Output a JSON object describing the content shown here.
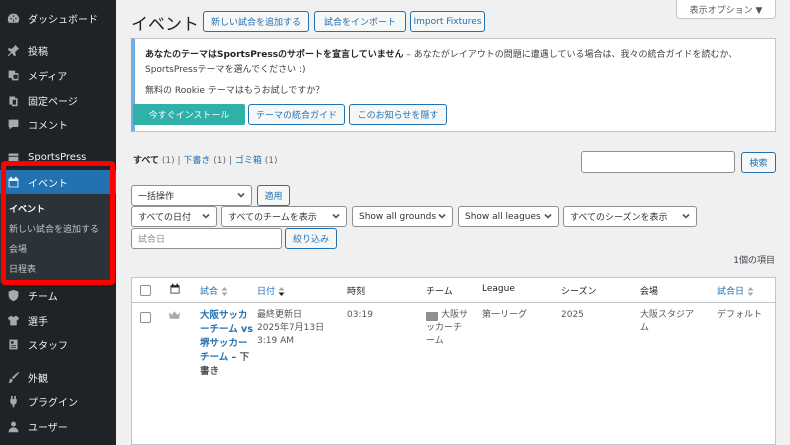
{
  "sidebar": {
    "items": [
      {
        "label": "ダッシュボード",
        "icon": "dashboard-icon"
      },
      {
        "label": "投稿",
        "icon": "pin-icon"
      },
      {
        "label": "メディア",
        "icon": "media-icon"
      },
      {
        "label": "固定ページ",
        "icon": "page-icon"
      },
      {
        "label": "コメント",
        "icon": "comment-icon"
      },
      {
        "label": "SportsPress",
        "icon": "sportspress-icon"
      },
      {
        "label": "イベント",
        "icon": "calendar-icon"
      },
      {
        "label": "チーム",
        "icon": "shield-icon"
      },
      {
        "label": "選手",
        "icon": "shirt-icon"
      },
      {
        "label": "スタッフ",
        "icon": "id-card-icon"
      },
      {
        "label": "外観",
        "icon": "brush-icon"
      },
      {
        "label": "プラグイン",
        "icon": "plugin-icon"
      },
      {
        "label": "ユーザー",
        "icon": "user-icon"
      }
    ],
    "submenu": [
      "イベント",
      "新しい試合を追加する",
      "会場",
      "日程表"
    ]
  },
  "header": {
    "title": "イベント",
    "buttons": [
      "新しい試合を追加する",
      "試合をインポート",
      "Import Fixtures"
    ],
    "screen_options": "表示オプション ▼"
  },
  "notice": {
    "bold": "あなたのテーマはSportsPressのサポートを宣言していません",
    "text_1": " – あなたがレイアウトの問題に遭遇している場合は、我々の統合ガイドを読むか、",
    "text_2": "SportsPressテーマを選んでください :)",
    "text_3": "無料の Rookie テーマはもうお試しですか？",
    "install": "今すぐインストール",
    "guide": "テーマの統合ガイド",
    "hide": "このお知らせを隠す"
  },
  "views": {
    "all": "すべて",
    "all_count": " (1) ",
    "sep": "|",
    "draft": "下書き",
    "draft_count": " (1) ",
    "trash": "ゴミ箱",
    "trash_count": " (1)"
  },
  "search": {
    "button": "検索",
    "placeholder": ""
  },
  "filters": {
    "bulk": "一括操作",
    "apply": "適用",
    "dates": "すべての日付",
    "teams": "すべてのチームを表示",
    "grounds": "Show all grounds",
    "leagues": "Show all leagues",
    "seasons": "すべてのシーズンを表示",
    "date_placeholder": "試合日",
    "filter": "絞り込み"
  },
  "item_count": "1個の項目",
  "table": {
    "columns": [
      "試合",
      "日付",
      "時刻",
      "チーム",
      "League",
      "シーズン",
      "会場",
      "試合日"
    ],
    "row": {
      "title": "大阪サッカーチーム vs 堺サッカーチーム",
      "state": "– 下書き",
      "date_line1": "最終更新日",
      "date_line2": "2025年7月13日",
      "date_line3": "3:19 AM",
      "time": "03:19",
      "team": "大阪サッカーチーム",
      "league": "第一リーグ",
      "season": "2025",
      "venue": "大阪スタジアム",
      "day": "デフォルト"
    }
  },
  "colors": {
    "sidebar": "#1d2327",
    "accent": "#2271b1",
    "highlight": "#ff0000",
    "primary_button": "#2fb0a8"
  }
}
